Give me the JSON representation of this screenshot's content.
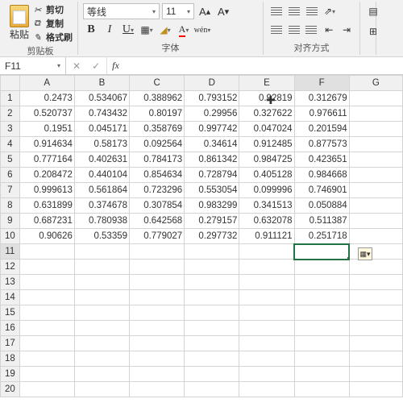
{
  "ribbon": {
    "clipboard": {
      "paste": "粘贴",
      "cut": "剪切",
      "copy": "复制",
      "format_painter": "格式刷",
      "group_label": "剪贴板"
    },
    "font": {
      "name": "等线",
      "size": "11",
      "bold": "B",
      "italic": "I",
      "underline": "U",
      "wen": "wén",
      "group_label": "字体"
    },
    "align": {
      "group_label": "对齐方式"
    }
  },
  "namebox": {
    "ref": "F11",
    "fx": "fx"
  },
  "sheet": {
    "columns": [
      "A",
      "B",
      "C",
      "D",
      "E",
      "F",
      "G"
    ],
    "rows": [
      "1",
      "2",
      "3",
      "4",
      "5",
      "6",
      "7",
      "8",
      "9",
      "10",
      "11",
      "12",
      "13",
      "14",
      "15",
      "16",
      "17",
      "18",
      "19",
      "20"
    ],
    "data": [
      [
        "0.2473",
        "0.534067",
        "0.388962",
        "0.793152",
        "0.92819",
        "0.312679"
      ],
      [
        "0.520737",
        "0.743432",
        "0.80197",
        "0.29956",
        "0.327622",
        "0.976611"
      ],
      [
        "0.1951",
        "0.045171",
        "0.358769",
        "0.997742",
        "0.047024",
        "0.201594"
      ],
      [
        "0.914634",
        "0.58173",
        "0.092564",
        "0.34614",
        "0.912485",
        "0.877573"
      ],
      [
        "0.777164",
        "0.402631",
        "0.784173",
        "0.861342",
        "0.984725",
        "0.423651"
      ],
      [
        "0.208472",
        "0.440104",
        "0.854634",
        "0.728794",
        "0.405128",
        "0.984668"
      ],
      [
        "0.999613",
        "0.561864",
        "0.723296",
        "0.553054",
        "0.099996",
        "0.746901"
      ],
      [
        "0.631899",
        "0.374678",
        "0.307854",
        "0.983299",
        "0.341513",
        "0.050884"
      ],
      [
        "0.687231",
        "0.780938",
        "0.642568",
        "0.279157",
        "0.632078",
        "0.511387"
      ],
      [
        "0.90626",
        "0.53359",
        "0.779027",
        "0.297732",
        "0.911121",
        "0.251718"
      ]
    ],
    "selected_cell": "F11",
    "selected_col": "F",
    "selected_row": "11"
  },
  "chart_data": {
    "type": "table",
    "columns": [
      "A",
      "B",
      "C",
      "D",
      "E",
      "F"
    ],
    "rows": [
      [
        0.2473,
        0.534067,
        0.388962,
        0.793152,
        0.92819,
        0.312679
      ],
      [
        0.520737,
        0.743432,
        0.80197,
        0.29956,
        0.327622,
        0.976611
      ],
      [
        0.1951,
        0.045171,
        0.358769,
        0.997742,
        0.047024,
        0.201594
      ],
      [
        0.914634,
        0.58173,
        0.092564,
        0.34614,
        0.912485,
        0.877573
      ],
      [
        0.777164,
        0.402631,
        0.784173,
        0.861342,
        0.984725,
        0.423651
      ],
      [
        0.208472,
        0.440104,
        0.854634,
        0.728794,
        0.405128,
        0.984668
      ],
      [
        0.999613,
        0.561864,
        0.723296,
        0.553054,
        0.099996,
        0.746901
      ],
      [
        0.631899,
        0.374678,
        0.307854,
        0.983299,
        0.341513,
        0.050884
      ],
      [
        0.687231,
        0.780938,
        0.642568,
        0.279157,
        0.632078,
        0.511387
      ],
      [
        0.90626,
        0.53359,
        0.779027,
        0.297732,
        0.911121,
        0.251718
      ]
    ]
  }
}
